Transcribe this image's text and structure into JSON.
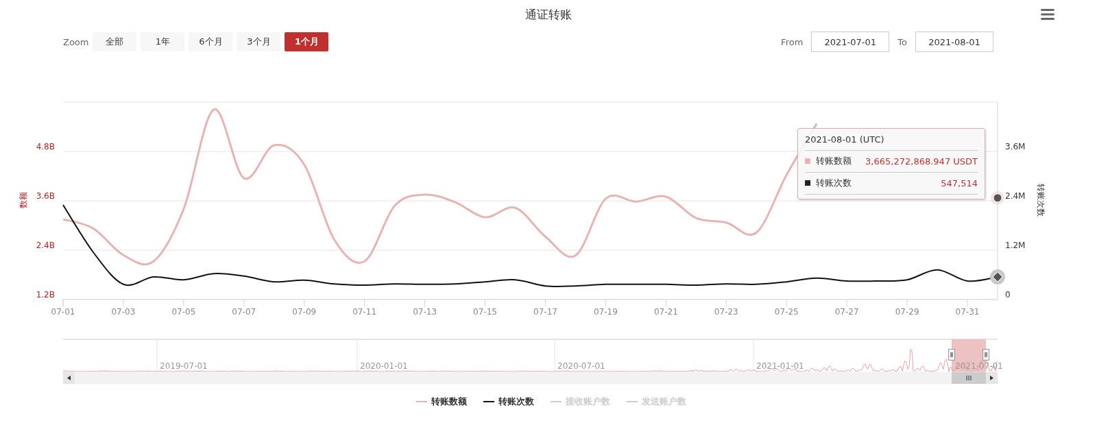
{
  "title": "通证转账",
  "range_selector": {
    "label": "Zoom",
    "buttons": [
      {
        "label": "全部",
        "selected": false
      },
      {
        "label": "1年",
        "selected": false
      },
      {
        "label": "6个月",
        "selected": false
      },
      {
        "label": "3个月",
        "selected": false
      },
      {
        "label": "1个月",
        "selected": true
      }
    ],
    "from_label": "From",
    "from_value": "2021-07-01",
    "to_label": "To",
    "to_value": "2021-08-01"
  },
  "chart": {
    "chart_data": {
      "type": "line",
      "ylabel": "数额",
      "y2label": "转账次数",
      "categories": [
        "07-01",
        null,
        "07-03",
        null,
        "07-05",
        null,
        "07-07",
        null,
        "07-09",
        null,
        "07-11",
        null,
        "07-13",
        null,
        "07-15",
        null,
        "07-17",
        null,
        "07-19",
        null,
        "07-21",
        null,
        "07-23",
        null,
        "07-25",
        null,
        "07-27",
        null,
        "07-29",
        null,
        "07-31",
        null
      ],
      "grid": true,
      "ylim": [
        1.2,
        6.0
      ],
      "yticks": [
        {
          "value": 1.2,
          "label": "1.2B"
        },
        {
          "value": 2.4,
          "label": "2.4B"
        },
        {
          "value": 3.6,
          "label": "3.6B"
        },
        {
          "value": 4.8,
          "label": "4.8B"
        }
      ],
      "y2lim": [
        0,
        4.8
      ],
      "y2ticks": [
        {
          "value": 0,
          "label": "0"
        },
        {
          "value": 1.2,
          "label": "1.2M"
        },
        {
          "value": 2.4,
          "label": "2.4M"
        },
        {
          "value": 3.6,
          "label": "3.6M"
        }
      ],
      "series": [
        {
          "name": "转账数额",
          "color": "#e8b3b3",
          "values": [
            3.15,
            2.93,
            2.28,
            2.13,
            3.4,
            5.82,
            4.15,
            4.95,
            4.48,
            2.65,
            2.13,
            3.48,
            3.75,
            3.57,
            3.2,
            3.43,
            2.73,
            2.27,
            3.65,
            3.58,
            3.7,
            3.18,
            3.07,
            2.83,
            4.23,
            5.48,
            null,
            null,
            null,
            null,
            null,
            3.67
          ]
        },
        {
          "name": "转账次数",
          "color": "#111111",
          "axis": "y2",
          "values": [
            2.3,
            1.15,
            0.37,
            0.55,
            0.48,
            0.63,
            0.57,
            0.43,
            0.47,
            0.38,
            0.35,
            0.38,
            0.37,
            0.38,
            0.43,
            0.48,
            0.33,
            0.33,
            0.37,
            0.37,
            0.37,
            0.35,
            0.38,
            0.37,
            0.43,
            0.52,
            0.45,
            0.45,
            0.48,
            0.72,
            0.45,
            0.55
          ]
        }
      ]
    },
    "tooltip": {
      "date": "2021-08-01 (UTC)",
      "rows": [
        {
          "name": "转账数额",
          "value": "3,665,272,868.947 USDT",
          "color": "#e8b3b3"
        },
        {
          "name": "转账次数",
          "value": "547,514",
          "color": "#222222"
        }
      ]
    }
  },
  "navigator": {
    "labels": [
      "2019-07-01",
      "2020-01-01",
      "2020-07-01",
      "2021-01-01",
      "2021-07-01"
    ]
  },
  "legend": [
    {
      "visible": true
    },
    {
      "visible": true
    },
    {
      "label": "接收账户数",
      "visible": false
    },
    {
      "label": "发送账户数",
      "visible": false
    }
  ]
}
